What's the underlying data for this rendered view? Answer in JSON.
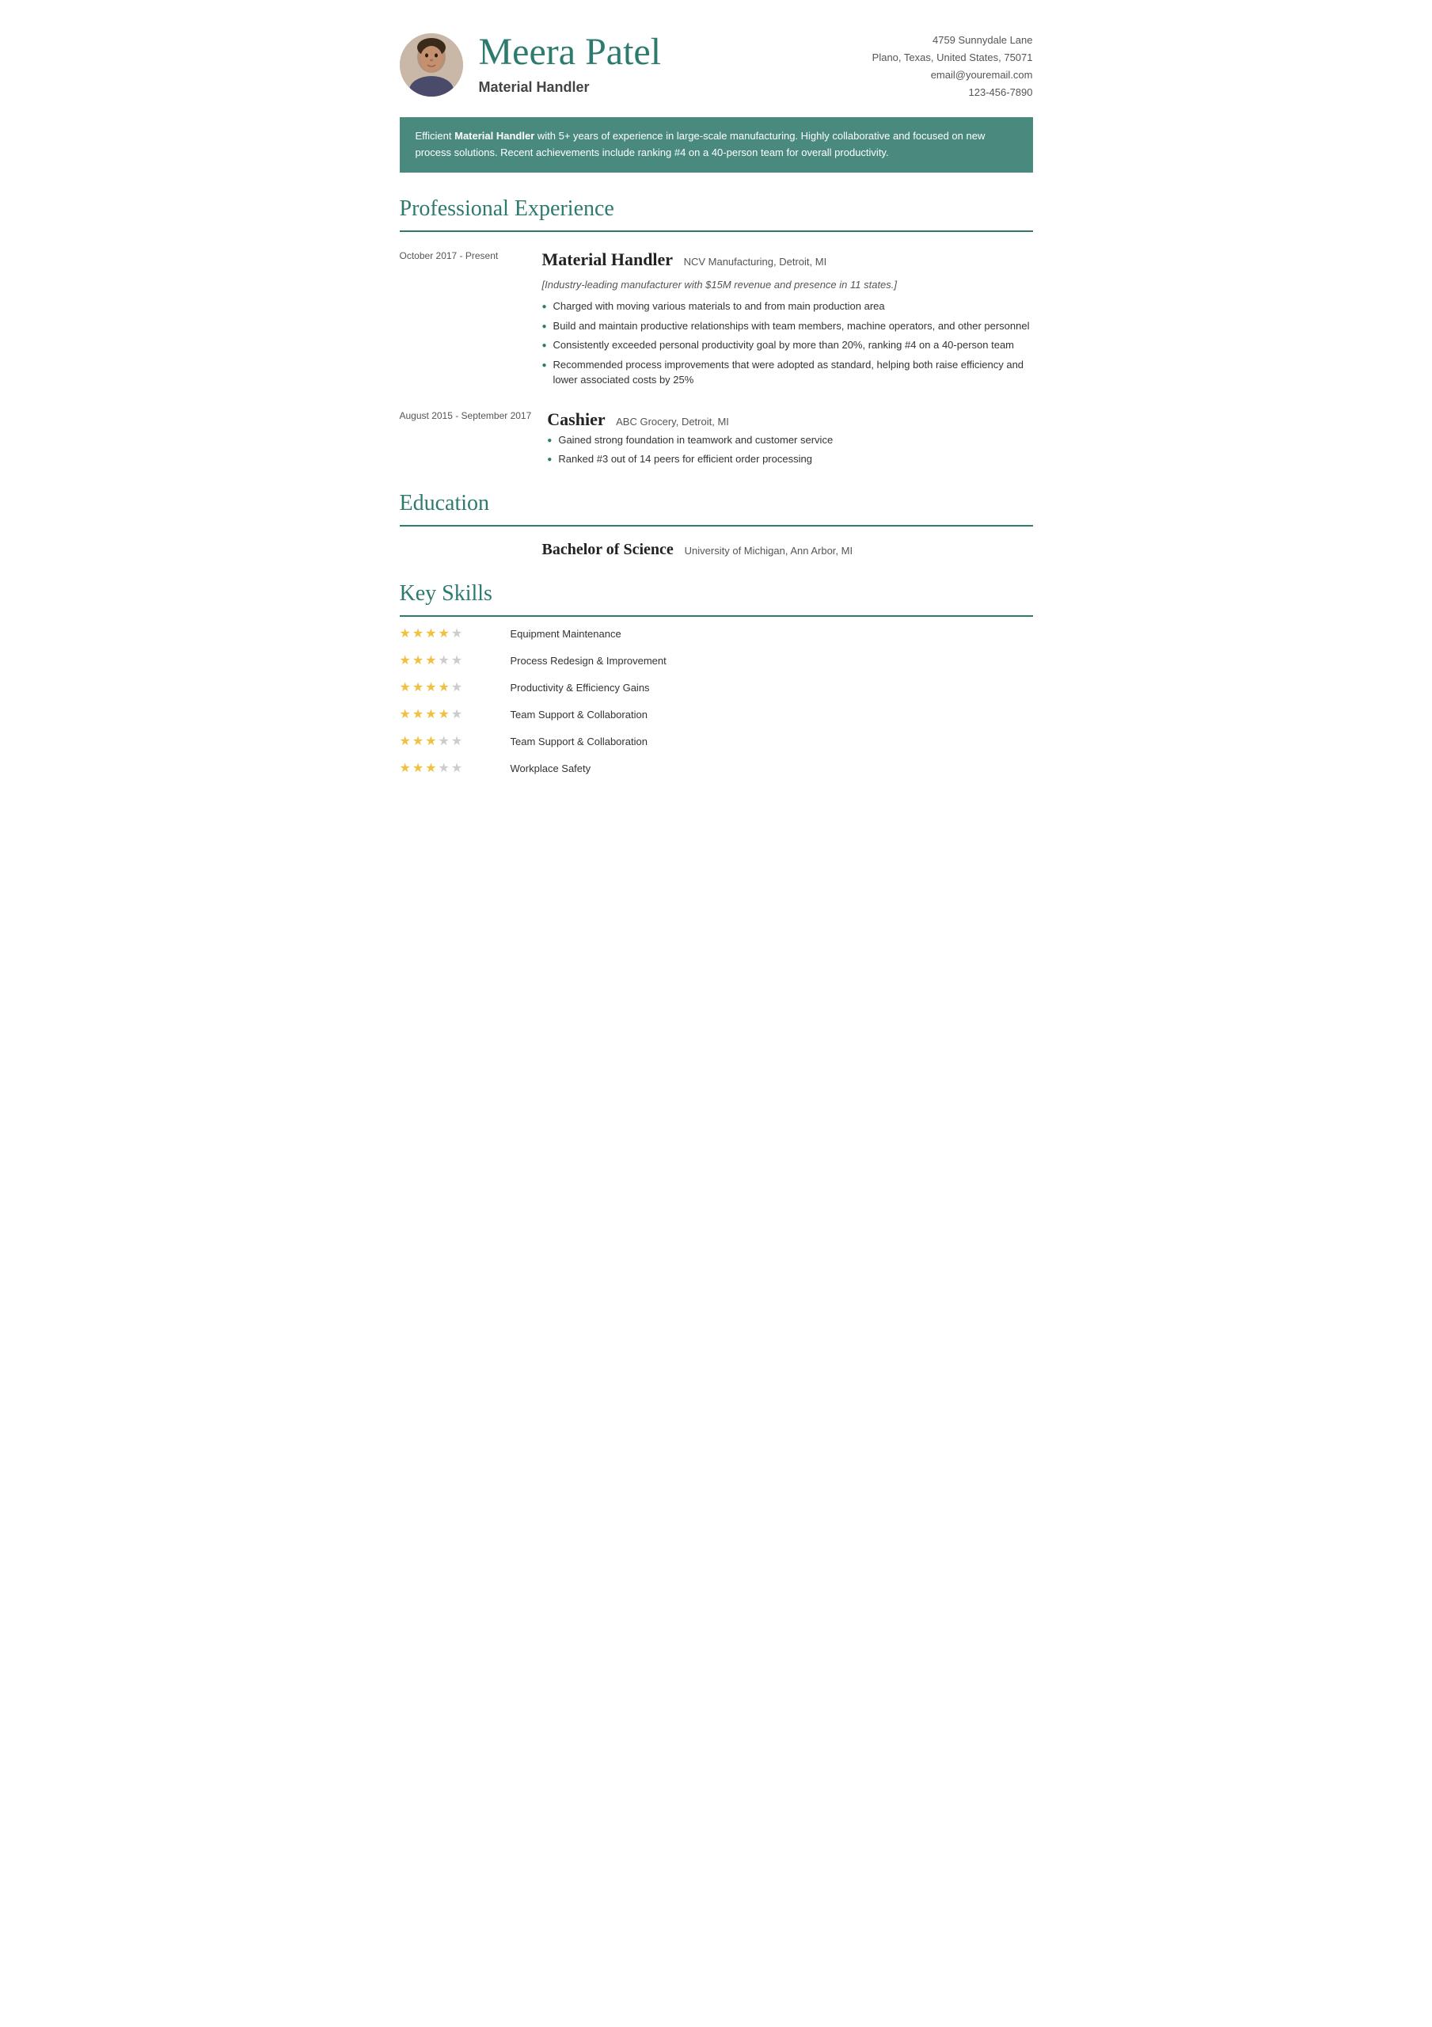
{
  "header": {
    "name": "Meera Patel",
    "title": "Material Handler",
    "avatar_alt": "Profile photo of Meera Patel",
    "contact": {
      "address": "4759 Sunnydale Lane",
      "city_state": "Plano, Texas, United States, 75071",
      "email": "email@youremail.com",
      "phone": "123-456-7890"
    }
  },
  "summary": {
    "text_before_bold": "Efficient ",
    "bold_text": "Material Handler",
    "text_after": " with 5+ years of experience  in large-scale manufacturing. Highly collaborative and focused on new  process solutions. Recent achievements include ranking #4 on a 40-person  team for overall productivity."
  },
  "professional_experience": {
    "section_label": "Professional Experience",
    "jobs": [
      {
        "dates": "October 2017 - Present",
        "job_title": "Material Handler",
        "company": "NCV Manufacturing, Detroit, MI",
        "description": "[Industry-leading manufacturer with $15M revenue and presence in 11 states.]",
        "bullets": [
          "Charged with moving various materials to and from main production area",
          "Build and maintain productive relationships with team members, machine operators, and other personnel",
          "Consistently exceeded personal productivity goal by more than 20%, ranking #4 on a 40-person team",
          "Recommended process improvements that were adopted as standard, helping both raise efficiency and lower associated costs by 25%"
        ]
      },
      {
        "dates": "August 2015 - September 2017",
        "job_title": "Cashier",
        "company": "ABC Grocery, Detroit, MI",
        "description": "",
        "bullets": [
          "Gained strong foundation in teamwork and customer service",
          "Ranked #3 out of 14 peers for efficient order processing"
        ]
      }
    ]
  },
  "education": {
    "section_label": "Education",
    "entries": [
      {
        "degree": "Bachelor of Science",
        "school": "University of Michigan, Ann Arbor, MI"
      }
    ]
  },
  "skills": {
    "section_label": "Key Skills",
    "entries": [
      {
        "name": "Equipment Maintenance",
        "filled": 4,
        "empty": 1
      },
      {
        "name": "Process Redesign & Improvement",
        "filled": 3,
        "empty": 2
      },
      {
        "name": "Productivity & Efficiency Gains",
        "filled": 4,
        "empty": 1
      },
      {
        "name": "Team Support & Collaboration",
        "filled": 4,
        "empty": 1
      },
      {
        "name": "Team Support & Collaboration",
        "filled": 3,
        "empty": 2
      },
      {
        "name": "Workplace Safety",
        "filled": 3,
        "empty": 2
      }
    ]
  }
}
